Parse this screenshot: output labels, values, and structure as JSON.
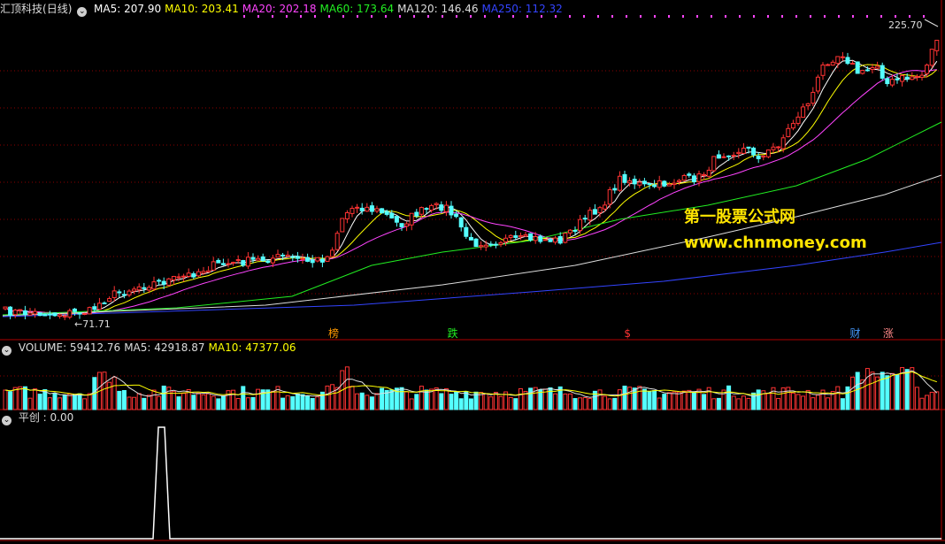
{
  "stock": {
    "name": "汇顶科技",
    "period": "(日线)"
  },
  "ma_legend": [
    {
      "label": "MA5: 207.90",
      "color": "#ffffff"
    },
    {
      "label": "MA10: 203.41",
      "color": "#ffff00"
    },
    {
      "label": "MA20: 202.18",
      "color": "#ff44ff"
    },
    {
      "label": "MA60: 173.64",
      "color": "#22ee22"
    },
    {
      "label": "MA120: 146.46",
      "color": "#dddddd"
    },
    {
      "label": "MA250: 112.32",
      "color": "#3344ff"
    }
  ],
  "price_marks": {
    "high": "225.70",
    "low": "71.71"
  },
  "event_tags": [
    {
      "label": "榜",
      "color": "#ff9900",
      "pos": 0.353
    },
    {
      "label": "跌",
      "color": "#22ee22",
      "pos": 0.479
    },
    {
      "label": "$",
      "color": "#ff3333",
      "pos": 0.664
    },
    {
      "label": "财",
      "color": "#4499ff",
      "pos": 0.905
    },
    {
      "label": "涨",
      "color": "#ff8888",
      "pos": 0.94
    }
  ],
  "volume_legend": [
    {
      "label": "VOLUME: 59412.76",
      "color": "#dddddd"
    },
    {
      "label": "MA5: 42918.87",
      "color": "#dddddd"
    },
    {
      "label": "MA10: 47377.06",
      "color": "#ffff00"
    }
  ],
  "indicator_legend": {
    "label": "平创 : 0.00",
    "color": "#dddddd"
  },
  "watermark": {
    "line1": "第一股票公式网",
    "line2": "www.chnmoney.com"
  },
  "colors": {
    "up": "#ff3333",
    "down": "#55ffff",
    "grid": "#8b0000",
    "border": "#b00000"
  }
}
